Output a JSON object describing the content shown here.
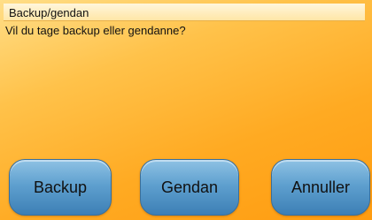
{
  "dialog": {
    "title": "Backup/gendan",
    "message": "Vil du tage backup eller gendanne?"
  },
  "buttons": {
    "backup_label": "Backup",
    "gendan_label": "Gendan",
    "annuller_label": "Annuller"
  },
  "colors": {
    "background": "#ffaa22",
    "title_bar": "#ffe6a6",
    "button": "#5fa0cf"
  }
}
